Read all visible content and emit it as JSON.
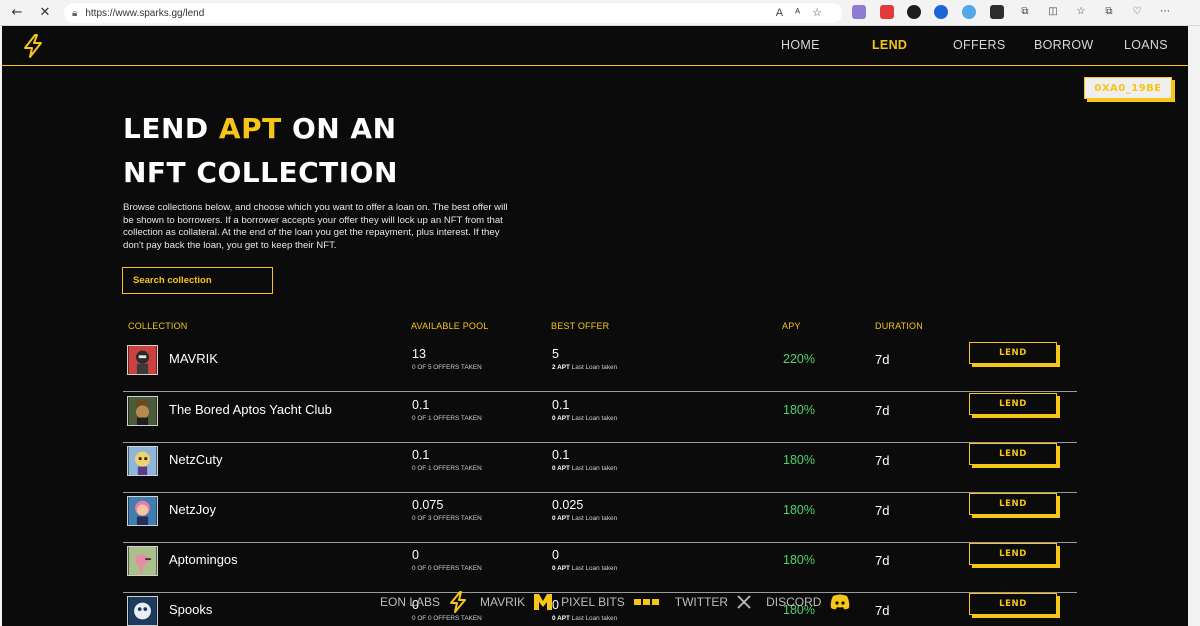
{
  "browser": {
    "url": "https://www.sparks.gg/lend",
    "back": "←",
    "close": "✕"
  },
  "nav": {
    "items": [
      {
        "label": "HOME",
        "active": false
      },
      {
        "label": "LEND",
        "active": true
      },
      {
        "label": "OFFERS",
        "active": false
      },
      {
        "label": "BORROW",
        "active": false
      },
      {
        "label": "LOANS",
        "active": false
      }
    ],
    "wallet": "0XA0_19BE"
  },
  "hero": {
    "line1_pre": "LEND ",
    "line1_accent": "APT",
    "line1_post": " ON AN",
    "line2": "NFT COLLECTION",
    "description": "Browse collections below, and choose which you want to offer a loan on. The best offer will be shown to borrowers. If a borrower accepts your offer they will lock up an NFT from that collection as collateral. At the end of the loan you get the repayment, plus interest. If they don't pay back the loan, you get to keep their NFT."
  },
  "search": {
    "placeholder": "Search collection"
  },
  "table": {
    "headers": {
      "collection": "COLLECTION",
      "pool": "AVAILABLE POOL",
      "offer": "BEST OFFER",
      "apy": "APY",
      "duration": "DURATION"
    },
    "rows": [
      {
        "name": "MAVRIK",
        "pool": "13",
        "pool_sub": "0 OF 5 OFFERS TAKEN",
        "offer": "5",
        "last_amount": "2 APT",
        "last_label": " Last Loan taken",
        "apy": "220%",
        "duration": "7d",
        "action": "LEND",
        "avatar_color": "#c9423f"
      },
      {
        "name": "The Bored Aptos Yacht Club",
        "pool": "0.1",
        "pool_sub": "0 OF 1 OFFERS TAKEN",
        "offer": "0.1",
        "last_amount": "0 APT",
        "last_label": " Last Loan taken",
        "apy": "180%",
        "duration": "7d",
        "action": "LEND",
        "avatar_color": "#6b5a2e"
      },
      {
        "name": "NetzCuty",
        "pool": "0.1",
        "pool_sub": "0 OF 1 OFFERS TAKEN",
        "offer": "0.1",
        "last_amount": "0 APT",
        "last_label": " Last Loan taken",
        "apy": "180%",
        "duration": "7d",
        "action": "LEND",
        "avatar_color": "#8fb6d8"
      },
      {
        "name": "NetzJoy",
        "pool": "0.075",
        "pool_sub": "0 OF 3 OFFERS TAKEN",
        "offer": "0.025",
        "last_amount": "0 APT",
        "last_label": " Last Loan taken",
        "apy": "180%",
        "duration": "7d",
        "action": "LEND",
        "avatar_color": "#3f7fb0"
      },
      {
        "name": "Aptomingos",
        "pool": "0",
        "pool_sub": "0 OF 0 OFFERS TAKEN",
        "offer": "0",
        "last_amount": "0 APT",
        "last_label": " Last Loan taken",
        "apy": "180%",
        "duration": "7d",
        "action": "LEND",
        "avatar_color": "#8aa06a"
      },
      {
        "name": "Spooks",
        "pool": "0",
        "pool_sub": "0 OF 0 OFFERS TAKEN",
        "offer": "0",
        "last_amount": "0 APT",
        "last_label": " Last Loan taken",
        "apy": "180%",
        "duration": "7d",
        "action": "LEND",
        "avatar_color": "#1d3b5c"
      }
    ]
  },
  "footer": {
    "items": [
      {
        "label": "EON LABS",
        "icon": "bolt-icon"
      },
      {
        "label": "MAVRIK",
        "icon": "m-logo-icon"
      },
      {
        "label": "PIXEL BITS",
        "icon": "pixel-bits-icon"
      },
      {
        "label": "TWITTER",
        "icon": "x-icon"
      },
      {
        "label": "DISCORD",
        "icon": "discord-icon"
      }
    ]
  },
  "colors": {
    "accent": "#f5c518",
    "background": "#0b0b0b",
    "apy_green": "#4fd36b"
  }
}
